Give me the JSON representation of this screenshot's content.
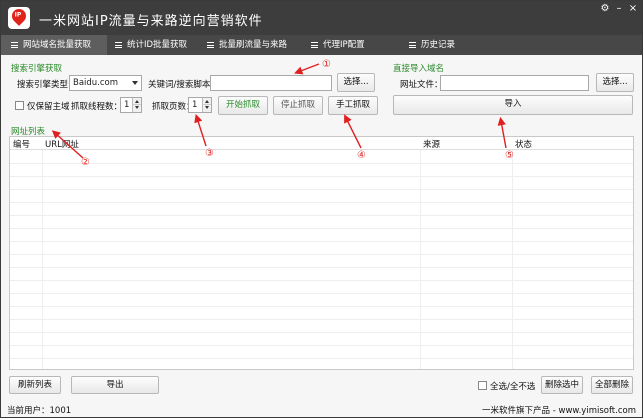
{
  "app": {
    "logo_text": "IP",
    "title": "一米网站IP流量与来路逆向营销软件"
  },
  "window_controls": {
    "settings": "⚙",
    "minimize": "–",
    "close": "×"
  },
  "tabs": [
    {
      "label": "网站域名批量获取",
      "active": true
    },
    {
      "label": "统计ID批量获取",
      "active": false
    },
    {
      "label": "批量刷流量与来路",
      "active": false
    },
    {
      "label": "代理IP配置",
      "active": false
    },
    {
      "label": "历史记录",
      "active": false
    }
  ],
  "search_engine": {
    "section_label": "搜索引擎获取",
    "engine_type_label": "搜索引擎类型：",
    "engine_value": "Baidu.com",
    "keyword_label": "关键词/搜索脚本：",
    "keyword_value": "",
    "choose_button": "选择...",
    "keep_main_domain_label": "仅保留主域",
    "thread_label": "抓取线程数：",
    "thread_value": "1",
    "pages_label": "抓取页数：",
    "pages_value": "1",
    "start_button": "开始抓取",
    "stop_button": "停止抓取",
    "manual_button": "手工抓取"
  },
  "direct_import": {
    "section_label": "直接导入域名",
    "file_label": "网址文件：",
    "file_value": "",
    "choose_button": "选择...",
    "import_button": "导入"
  },
  "url_list": {
    "section_label": "网址列表",
    "columns": [
      "编号",
      "URL网址",
      "来源",
      "状态"
    ],
    "rows": []
  },
  "annotations": [
    "①",
    "②",
    "③",
    "④",
    "⑤"
  ],
  "bottom": {
    "refresh_button": "刷新列表",
    "export_button": "导出",
    "select_all_label": "全选/全不选",
    "delete_selected_button": "删除选中",
    "delete_all_button": "全部删除"
  },
  "status": {
    "current_user": "当前用户：1001",
    "footer": "一米软件旗下产品 - www.yimisoft.com"
  },
  "colors": {
    "titlebar": "#3d3d3d",
    "tabbar": "#474747",
    "section_green": "#2a8a2a",
    "annotation_red": "#e02020"
  }
}
